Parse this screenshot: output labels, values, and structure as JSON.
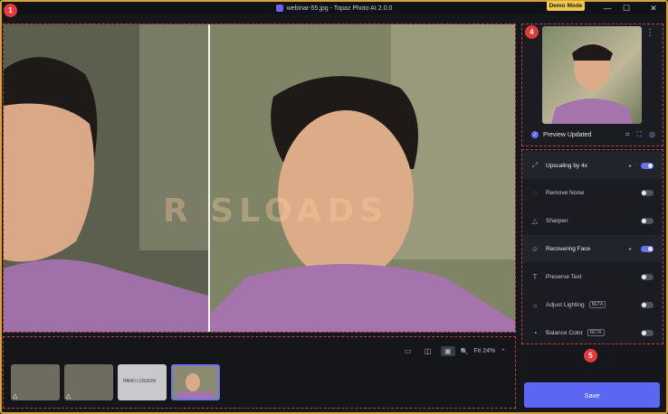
{
  "window": {
    "title": "webinar-55.jpg - Topaz Photo AI 2.0.0",
    "demo_mode": "Demo Mode",
    "minimize_icon": "—",
    "maximize_icon": "☐",
    "close_icon": "✕"
  },
  "markers": {
    "m1": "1",
    "m4": "4",
    "m5": "5"
  },
  "watermark_text": "R SLOADS",
  "view_controls": {
    "zoom_label": "Fit 24%"
  },
  "filmstrip": {
    "thumb_labels": [
      "",
      "",
      "PANO LOSSON",
      ""
    ]
  },
  "preview_panel": {
    "status": "Preview Updated"
  },
  "features": [
    {
      "label": "Upscaling by 4x",
      "enabled": true,
      "has_arrow": true
    },
    {
      "label": "Remove Noise",
      "enabled": false,
      "has_arrow": false
    },
    {
      "label": "Sharpen",
      "enabled": false,
      "has_arrow": false
    },
    {
      "label": "Recovering Face",
      "enabled": true,
      "has_arrow": true
    },
    {
      "label": "Preserve Text",
      "enabled": false,
      "has_arrow": false
    },
    {
      "label": "Adjust Lighting",
      "enabled": false,
      "has_arrow": false,
      "badge": "BETA"
    },
    {
      "label": "Balance Color",
      "enabled": false,
      "has_arrow": false,
      "badge": "BETA"
    }
  ],
  "save_label": "Save",
  "colors": {
    "accent": "#5b67f2",
    "demo": "#f1c84b",
    "marker": "#e23b3b"
  }
}
